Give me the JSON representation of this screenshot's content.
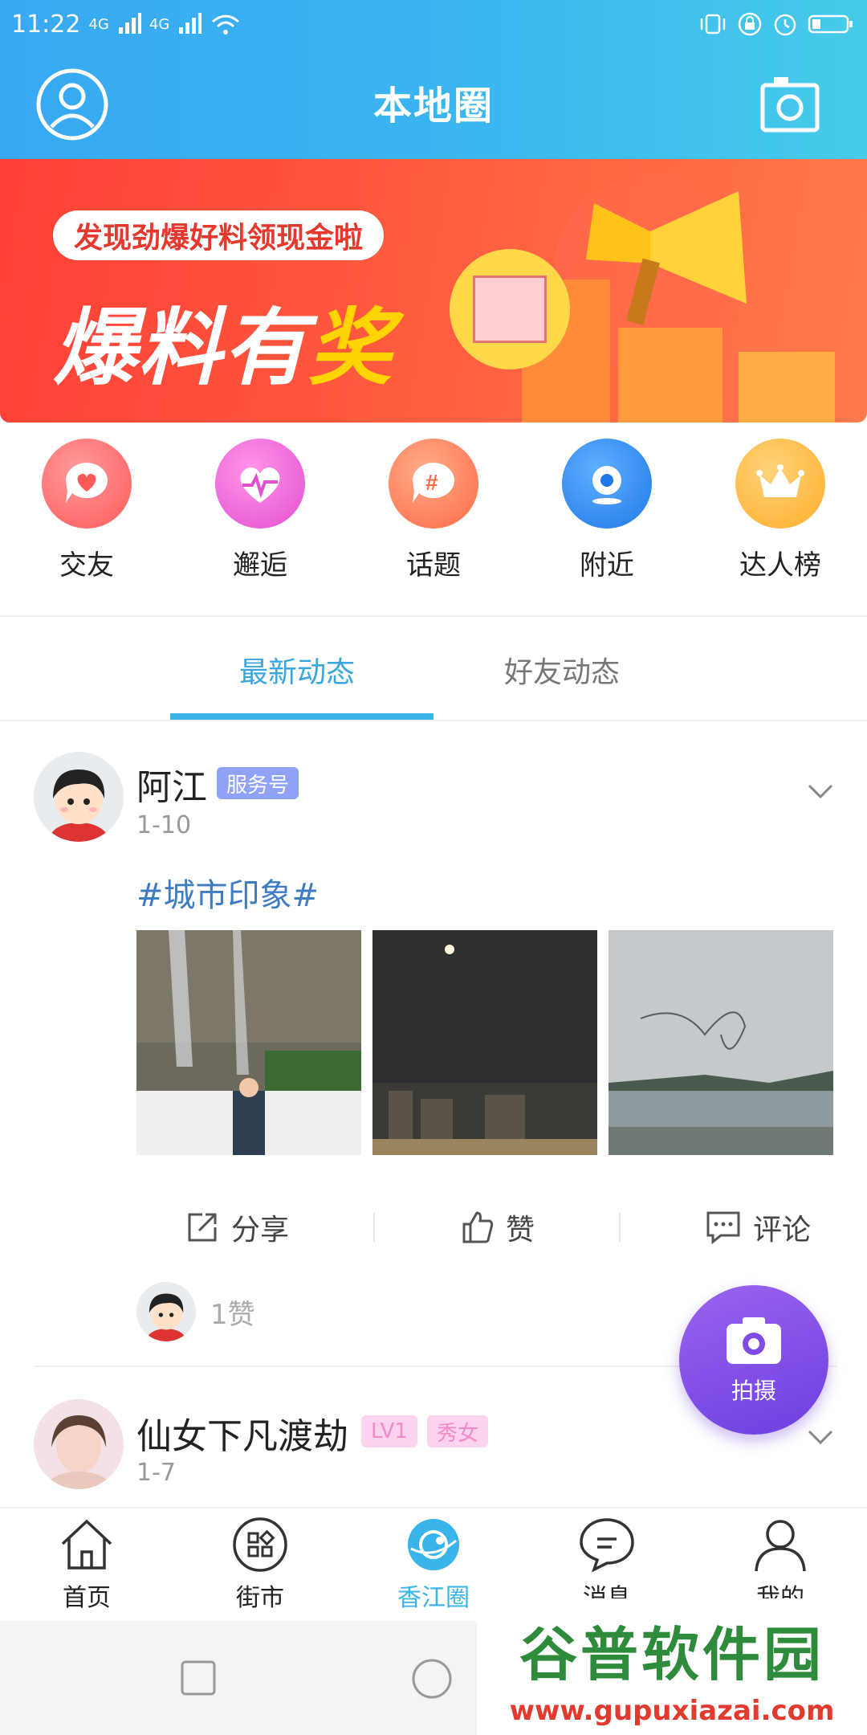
{
  "status": {
    "time": "11:22",
    "network1": "4G",
    "network2": "4G"
  },
  "header": {
    "title": "本地圈"
  },
  "banner": {
    "pill_text": "发现劲爆好料领现金啦",
    "headline_a": "爆料有",
    "headline_b": "奖"
  },
  "categories": [
    {
      "label": "交友",
      "color": "#ff6a6a",
      "icon": "heart-bubble-icon"
    },
    {
      "label": "邂逅",
      "color": "#f05fd0",
      "icon": "heartbeat-icon"
    },
    {
      "label": "话题",
      "color": "#ff7a55",
      "icon": "hashtag-bubble-icon"
    },
    {
      "label": "附近",
      "color": "#2f8ff0",
      "icon": "location-pin-icon"
    },
    {
      "label": "达人榜",
      "color": "#ffbc3a",
      "icon": "crown-icon"
    }
  ],
  "tabs": {
    "latest": "最新动态",
    "friends": "好友动态"
  },
  "post1": {
    "username": "阿江",
    "badge": "服务号",
    "date": "1-10",
    "hashtag": "#城市印象#",
    "actions": {
      "share": "分享",
      "like": "赞",
      "comment": "评论"
    },
    "likes": "1赞"
  },
  "post2": {
    "username": "仙女下凡渡劫",
    "level_badge": "LV1",
    "tag_badge": "秀女",
    "date": "1-7"
  },
  "fab": {
    "label": "拍摄"
  },
  "bottom_nav": [
    {
      "label": "首页",
      "icon": "home-icon"
    },
    {
      "label": "街市",
      "icon": "grid-apps-icon"
    },
    {
      "label": "香江圈",
      "icon": "circle-planet-icon"
    },
    {
      "label": "消息",
      "icon": "chat-icon"
    },
    {
      "label": "我的",
      "icon": "person-icon"
    }
  ],
  "watermark": {
    "line1": "谷普软件园",
    "line2": "www.gupuxiazai.com"
  }
}
